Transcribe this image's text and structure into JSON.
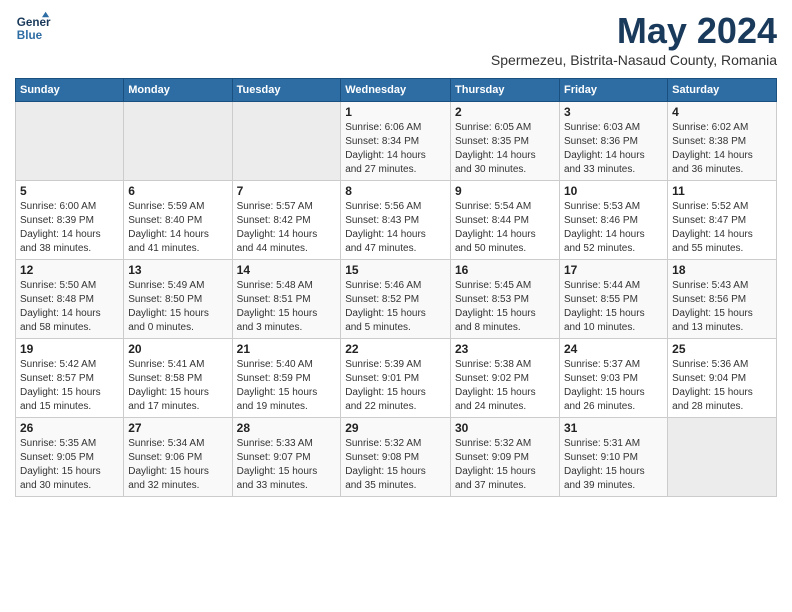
{
  "header": {
    "logo_line1": "General",
    "logo_line2": "Blue",
    "month_title": "May 2024",
    "subtitle": "Spermezeu, Bistrita-Nasaud County, Romania"
  },
  "days_of_week": [
    "Sunday",
    "Monday",
    "Tuesday",
    "Wednesday",
    "Thursday",
    "Friday",
    "Saturday"
  ],
  "weeks": [
    [
      {
        "num": "",
        "info": ""
      },
      {
        "num": "",
        "info": ""
      },
      {
        "num": "",
        "info": ""
      },
      {
        "num": "1",
        "info": "Sunrise: 6:06 AM\nSunset: 8:34 PM\nDaylight: 14 hours\nand 27 minutes."
      },
      {
        "num": "2",
        "info": "Sunrise: 6:05 AM\nSunset: 8:35 PM\nDaylight: 14 hours\nand 30 minutes."
      },
      {
        "num": "3",
        "info": "Sunrise: 6:03 AM\nSunset: 8:36 PM\nDaylight: 14 hours\nand 33 minutes."
      },
      {
        "num": "4",
        "info": "Sunrise: 6:02 AM\nSunset: 8:38 PM\nDaylight: 14 hours\nand 36 minutes."
      }
    ],
    [
      {
        "num": "5",
        "info": "Sunrise: 6:00 AM\nSunset: 8:39 PM\nDaylight: 14 hours\nand 38 minutes."
      },
      {
        "num": "6",
        "info": "Sunrise: 5:59 AM\nSunset: 8:40 PM\nDaylight: 14 hours\nand 41 minutes."
      },
      {
        "num": "7",
        "info": "Sunrise: 5:57 AM\nSunset: 8:42 PM\nDaylight: 14 hours\nand 44 minutes."
      },
      {
        "num": "8",
        "info": "Sunrise: 5:56 AM\nSunset: 8:43 PM\nDaylight: 14 hours\nand 47 minutes."
      },
      {
        "num": "9",
        "info": "Sunrise: 5:54 AM\nSunset: 8:44 PM\nDaylight: 14 hours\nand 50 minutes."
      },
      {
        "num": "10",
        "info": "Sunrise: 5:53 AM\nSunset: 8:46 PM\nDaylight: 14 hours\nand 52 minutes."
      },
      {
        "num": "11",
        "info": "Sunrise: 5:52 AM\nSunset: 8:47 PM\nDaylight: 14 hours\nand 55 minutes."
      }
    ],
    [
      {
        "num": "12",
        "info": "Sunrise: 5:50 AM\nSunset: 8:48 PM\nDaylight: 14 hours\nand 58 minutes."
      },
      {
        "num": "13",
        "info": "Sunrise: 5:49 AM\nSunset: 8:50 PM\nDaylight: 15 hours\nand 0 minutes."
      },
      {
        "num": "14",
        "info": "Sunrise: 5:48 AM\nSunset: 8:51 PM\nDaylight: 15 hours\nand 3 minutes."
      },
      {
        "num": "15",
        "info": "Sunrise: 5:46 AM\nSunset: 8:52 PM\nDaylight: 15 hours\nand 5 minutes."
      },
      {
        "num": "16",
        "info": "Sunrise: 5:45 AM\nSunset: 8:53 PM\nDaylight: 15 hours\nand 8 minutes."
      },
      {
        "num": "17",
        "info": "Sunrise: 5:44 AM\nSunset: 8:55 PM\nDaylight: 15 hours\nand 10 minutes."
      },
      {
        "num": "18",
        "info": "Sunrise: 5:43 AM\nSunset: 8:56 PM\nDaylight: 15 hours\nand 13 minutes."
      }
    ],
    [
      {
        "num": "19",
        "info": "Sunrise: 5:42 AM\nSunset: 8:57 PM\nDaylight: 15 hours\nand 15 minutes."
      },
      {
        "num": "20",
        "info": "Sunrise: 5:41 AM\nSunset: 8:58 PM\nDaylight: 15 hours\nand 17 minutes."
      },
      {
        "num": "21",
        "info": "Sunrise: 5:40 AM\nSunset: 8:59 PM\nDaylight: 15 hours\nand 19 minutes."
      },
      {
        "num": "22",
        "info": "Sunrise: 5:39 AM\nSunset: 9:01 PM\nDaylight: 15 hours\nand 22 minutes."
      },
      {
        "num": "23",
        "info": "Sunrise: 5:38 AM\nSunset: 9:02 PM\nDaylight: 15 hours\nand 24 minutes."
      },
      {
        "num": "24",
        "info": "Sunrise: 5:37 AM\nSunset: 9:03 PM\nDaylight: 15 hours\nand 26 minutes."
      },
      {
        "num": "25",
        "info": "Sunrise: 5:36 AM\nSunset: 9:04 PM\nDaylight: 15 hours\nand 28 minutes."
      }
    ],
    [
      {
        "num": "26",
        "info": "Sunrise: 5:35 AM\nSunset: 9:05 PM\nDaylight: 15 hours\nand 30 minutes."
      },
      {
        "num": "27",
        "info": "Sunrise: 5:34 AM\nSunset: 9:06 PM\nDaylight: 15 hours\nand 32 minutes."
      },
      {
        "num": "28",
        "info": "Sunrise: 5:33 AM\nSunset: 9:07 PM\nDaylight: 15 hours\nand 33 minutes."
      },
      {
        "num": "29",
        "info": "Sunrise: 5:32 AM\nSunset: 9:08 PM\nDaylight: 15 hours\nand 35 minutes."
      },
      {
        "num": "30",
        "info": "Sunrise: 5:32 AM\nSunset: 9:09 PM\nDaylight: 15 hours\nand 37 minutes."
      },
      {
        "num": "31",
        "info": "Sunrise: 5:31 AM\nSunset: 9:10 PM\nDaylight: 15 hours\nand 39 minutes."
      },
      {
        "num": "",
        "info": ""
      }
    ]
  ]
}
